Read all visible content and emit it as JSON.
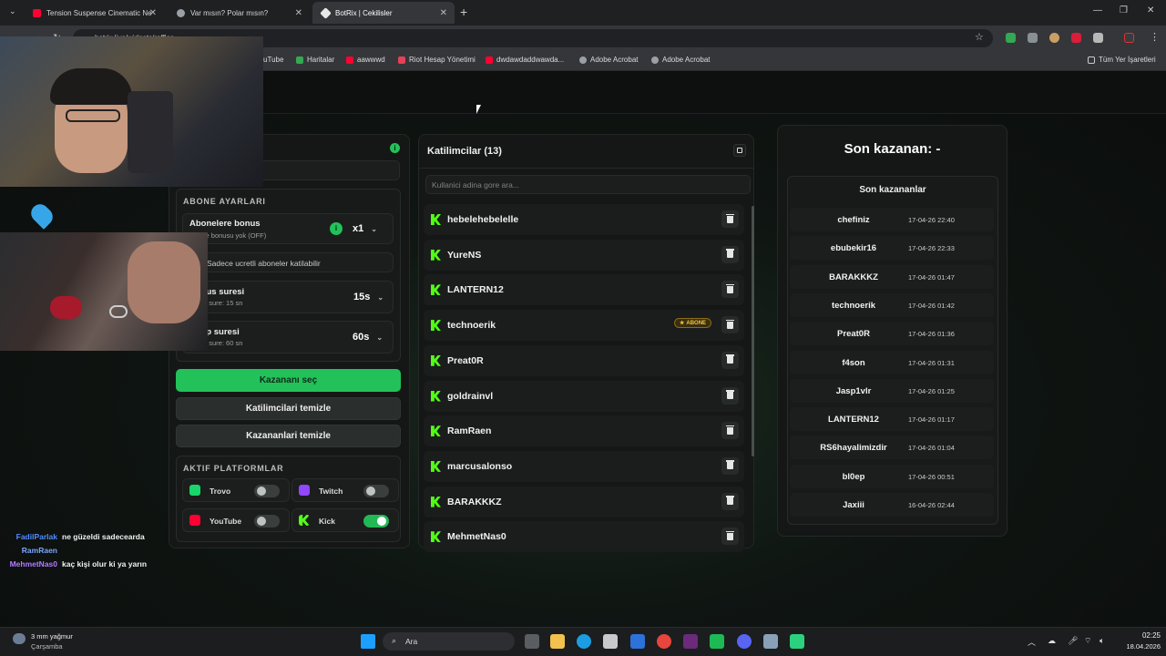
{
  "browser": {
    "tabs": [
      {
        "title": "Tension Suspense Cinematic Ne",
        "icon": "youtube-icon",
        "color": "#ff0033"
      },
      {
        "title": "Var mısın? Polar mısın?",
        "icon": "globe-icon",
        "color": "#9aa0a6"
      },
      {
        "title": "BotRix | Cekilisler",
        "icon": "botrix-icon",
        "color": "#e8e8e8"
      }
    ],
    "url": "botrix.live/widgets/raffles",
    "bookmarks": [
      {
        "label": "YouTube",
        "color": "#ff0033"
      },
      {
        "label": "Haritalar",
        "color": "#34a853"
      },
      {
        "label": "aawwwd",
        "color": "#ff0033"
      },
      {
        "label": "Riot Hesap Yönetimi",
        "color": "#e84057"
      },
      {
        "label": "dwdawdaddwawda...",
        "color": "#ff0033"
      },
      {
        "label": "Adobe Acrobat",
        "color": "#9aa0a6"
      },
      {
        "label": "Adobe Acrobat",
        "color": "#9aa0a6"
      }
    ],
    "all_bookmarks": "Tüm Yer İşaretleri"
  },
  "settings": {
    "subscriber_section_title": "ABONE AYARLARI",
    "bonus": {
      "label": "Abonelere bonus",
      "sub": "Abone bonusu yok (OFF)",
      "value": "x1"
    },
    "paid_only": "Sadece ucretli aboneler katilabilir",
    "bonus_time": {
      "label": "Bonus suresi",
      "sub": "Panel sure: 15 sn",
      "value": "15s"
    },
    "claim_time": {
      "label": "Talep suresi",
      "sub": "Panel sure: 60 sn",
      "value": "60s"
    },
    "pick_winner": "Kazananı seç",
    "clear_participants": "Katilimcilari temizle",
    "clear_winners": "Kazananlari temizle",
    "platforms_title": "AKTIF PLATFORMLAR",
    "platforms": [
      {
        "name": "Trovo",
        "color": "#19d66b",
        "enabled": false
      },
      {
        "name": "Twitch",
        "color": "#9146ff",
        "enabled": false
      },
      {
        "name": "YouTube",
        "color": "#ff0033",
        "enabled": false
      },
      {
        "name": "Kick",
        "color": "#53fc18",
        "enabled": true
      }
    ]
  },
  "participants": {
    "title": "Katilimcilar (13)",
    "search_placeholder": "Kullanici adina gore ara...",
    "abone_badge": "ABONE",
    "list": [
      "hebelehebelelle",
      "YureNS",
      "LANTERN12",
      "technoerik",
      "Preat0R",
      "goldrainvl",
      "RamRaen",
      "marcusalonso",
      "BARAKKKZ",
      "MehmetNas0"
    ]
  },
  "winners": {
    "last_winner": "Son kazanan: -",
    "list_title": "Son kazananlar",
    "list": [
      {
        "name": "chefiniz",
        "date": "17-04-26 22:40"
      },
      {
        "name": "ebubekir16",
        "date": "17-04-26 22:33"
      },
      {
        "name": "BARAKKKZ",
        "date": "17-04-26 01:47"
      },
      {
        "name": "technoerik",
        "date": "17-04-26 01:42"
      },
      {
        "name": "Preat0R",
        "date": "17-04-26 01:36"
      },
      {
        "name": "f4son",
        "date": "17-04-26 01:31"
      },
      {
        "name": "Jasp1vlr",
        "date": "17-04-26 01:25"
      },
      {
        "name": "LANTERN12",
        "date": "17-04-26 01:17"
      },
      {
        "name": "RS6hayalimizdir",
        "date": "17-04-26 01:04"
      },
      {
        "name": "bl0ep",
        "date": "17-04-26 00:51"
      },
      {
        "name": "Jaxiii",
        "date": "16-04-26 02:44"
      }
    ]
  },
  "chat": [
    {
      "user": "FadilParlak",
      "msg": "ne güzeldi sadecearda",
      "color": "#4f8cff"
    },
    {
      "user": "RamRaen",
      "msg": "",
      "color": "#7aa6ff"
    },
    {
      "user": "MehmetNas0",
      "msg": "kaç kişi olur ki ya yarın",
      "color": "#b07cff"
    }
  ],
  "taskbar": {
    "weather_temp": "3 mm yağmur",
    "weather_day": "Çarşamba",
    "search": "Ara",
    "time": "02:25",
    "date": "18.04.2026"
  }
}
